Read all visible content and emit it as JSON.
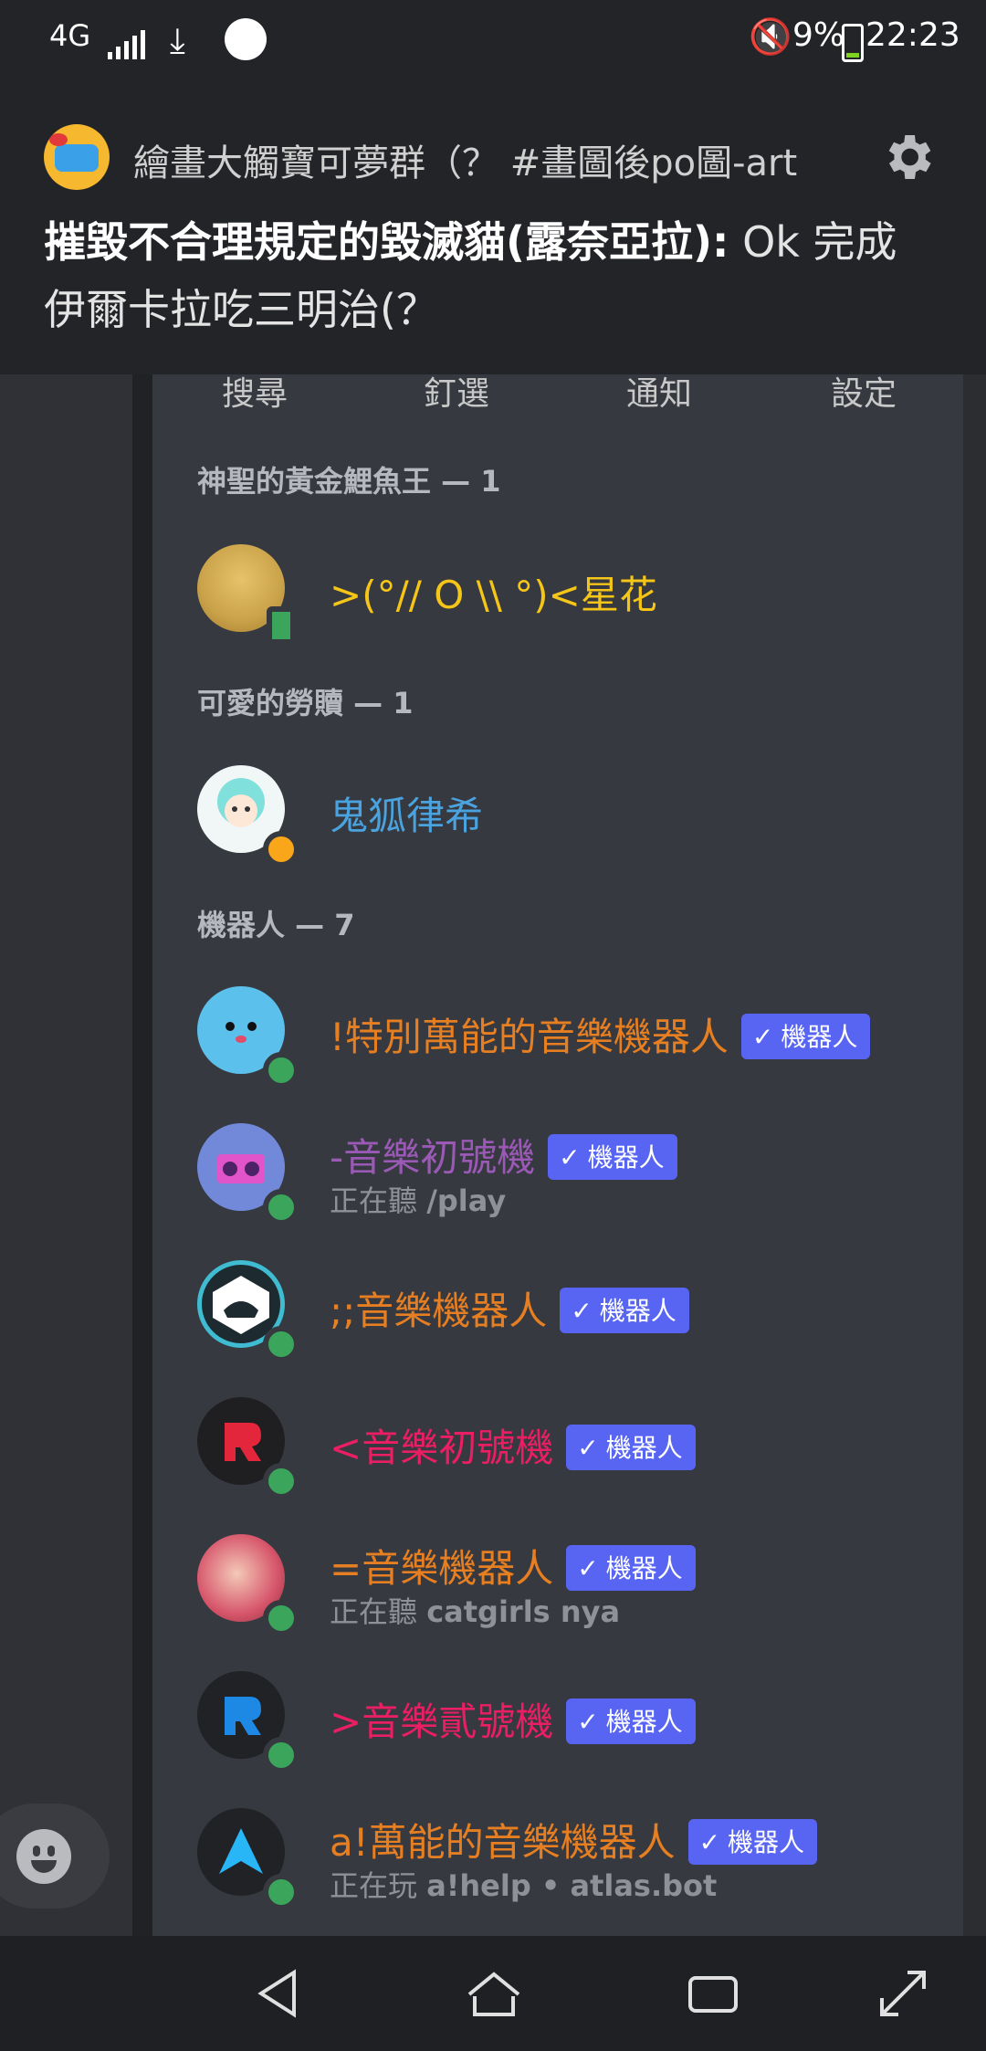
{
  "status_bar": {
    "network_type": "4G",
    "battery": "9%",
    "time": "22:23"
  },
  "notification": {
    "channel": "繪畫大觸寶可夢群（？ #畫圖後po圖-art",
    "author": "摧毀不合理規定的毀滅貓(露奈亞拉):",
    "message": " Ok 完成 伊爾卡拉吃三明治(？"
  },
  "tabs": [
    "搜尋",
    "釘選",
    "通知",
    "設定"
  ],
  "sections": [
    {
      "title": "神聖的黃金鯉魚王 — 1"
    },
    {
      "title": "可愛的勞贖 — 1"
    },
    {
      "title": "機器人 — 7"
    }
  ],
  "members": [
    {
      "name": ">(°//  O \\\\ °)<星花",
      "color": "#f5c518",
      "activity": "",
      "bot": false,
      "status": "mobile"
    },
    {
      "name": "鬼狐律希",
      "color": "#4aa3df",
      "activity": "",
      "bot": false,
      "status": "idle"
    },
    {
      "name": "!特別萬能的音樂機器人",
      "color": "#e67e22",
      "activity": "",
      "bot": true,
      "status": "online"
    },
    {
      "name": "-音樂初號機",
      "color": "#9b59b6",
      "activity_prefix": "正在聽 ",
      "activity_value": "/play",
      "bot": true,
      "status": "online"
    },
    {
      "name": ";;音樂機器人",
      "color": "#e67e22",
      "activity": "",
      "bot": true,
      "status": "online"
    },
    {
      "name": "<音樂初號機",
      "color": "#e91e63",
      "activity": "",
      "bot": true,
      "status": "online"
    },
    {
      "name": "=音樂機器人",
      "color": "#e67e22",
      "activity_prefix": "正在聽 ",
      "activity_value": "catgirls nya",
      "bot": true,
      "status": "online"
    },
    {
      "name": ">音樂貳號機",
      "color": "#e91e63",
      "activity": "",
      "bot": true,
      "status": "online"
    },
    {
      "name": "a!萬能的音樂機器人",
      "color": "#e67e22",
      "activity_prefix": "正在玩 ",
      "activity_value": "a!help • atlas.bot",
      "bot": true,
      "status": "online"
    }
  ],
  "bot_badge": "機器人",
  "bot_check": "✓"
}
